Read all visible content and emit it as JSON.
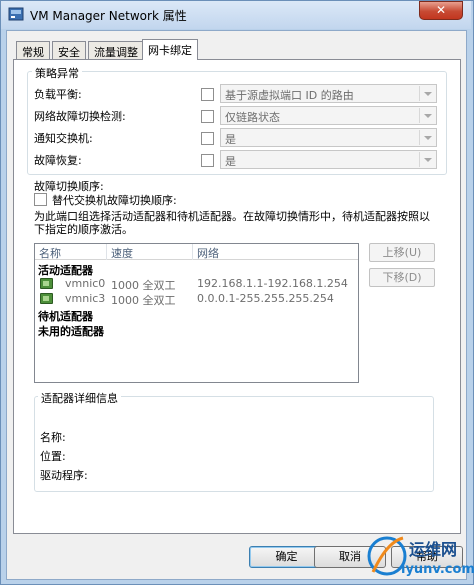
{
  "window": {
    "title": "VM Manager Network 属性",
    "close_label": "✕"
  },
  "tabs": [
    {
      "label": "常规"
    },
    {
      "label": "安全"
    },
    {
      "label": "流量调整"
    },
    {
      "label": "网卡绑定",
      "active": true
    }
  ],
  "policy": {
    "group_title": "策略异常",
    "rows": [
      {
        "label": "负载平衡:",
        "value": "基于源虚拟端口 ID 的路由"
      },
      {
        "label": "网络故障切换检测:",
        "value": "仅链路状态"
      },
      {
        "label": "通知交换机:",
        "value": "是"
      },
      {
        "label": "故障恢复:",
        "value": "是"
      }
    ]
  },
  "failover": {
    "heading": "故障切换顺序:",
    "override_label": "替代交换机故障切换顺序:",
    "description_line1": "为此端口组选择活动适配器和待机适配器。在故障切换情形中，待机适配器按照以",
    "description_line2": "下指定的顺序激活。",
    "columns": [
      "名称",
      "速度",
      "网络"
    ],
    "group_active": "活动适配器",
    "adapters": [
      {
        "name": "vmnic0",
        "speed": "1000 全双工",
        "network": "192.168.1.1-192.168.1.254"
      },
      {
        "name": "vmnic3",
        "speed": "1000 全双工",
        "network": "0.0.0.1-255.255.255.254"
      }
    ],
    "group_standby": "待机适配器",
    "group_unused": "未用的适配器",
    "move_up": "上移(U)",
    "move_down": "下移(D)"
  },
  "details": {
    "group_title": "适配器详细信息",
    "name_label": "名称:",
    "location_label": "位置:",
    "driver_label": "驱动程序:"
  },
  "footer": {
    "ok": "确定",
    "cancel": "取消",
    "help": "帮助"
  },
  "watermark": {
    "line1": "运维网",
    "line2": "iyunv.com"
  }
}
